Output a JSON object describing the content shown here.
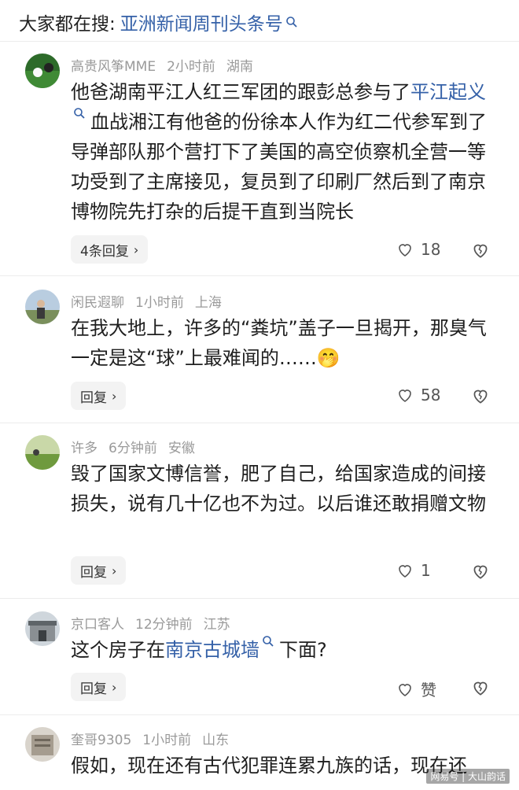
{
  "search": {
    "prefix": "大家都在搜:",
    "query": "亚洲新闻周刊头条号"
  },
  "comments": [
    {
      "user": "高贵风筝MME",
      "time": "2小时前",
      "location": "湖南",
      "text_before": "他爸湖南平江人红三军团的跟彭总参与了",
      "link": "平江起义",
      "text_after": "血战湘江有他爸的份徐本人作为红二代参军到了导弹部队那个营打下了美国的高空侦察机全营一等功受到了主席接见，复员到了印刷厂然后到了南京博物院先打杂的后提干直到当院长",
      "reply_label": "4条回复",
      "likes": "18"
    },
    {
      "user": "闲民遐聊",
      "time": "1小时前",
      "location": "上海",
      "text_before": "在我大地上，许多的“粪坑”盖子一旦揭开，那臭气一定是这“球”上最难闻的……",
      "emoji": "🤭",
      "reply_label": "回复",
      "likes": "58"
    },
    {
      "user": "许多",
      "time": "6分钟前",
      "location": "安徽",
      "text_before": "毁了国家文博信誉，肥了自己，给国家造成的间接损失，说有几十亿也不为过。以后谁还敢捐赠文物",
      "reply_label": "回复",
      "likes": "1"
    },
    {
      "user": "京口客人",
      "time": "12分钟前",
      "location": "江苏",
      "text_before": "这个房子在",
      "link": "南京古城墙",
      "text_after": "下面?",
      "reply_label": "回复",
      "likes": "赞"
    },
    {
      "user": "奎哥9305",
      "time": "1小时前",
      "location": "山东",
      "text_before": "假如，现在还有古代犯罪连累九族的话，现在还"
    }
  ],
  "watermark": "网易号 | 大山韵话",
  "colors": {
    "link": "#3561a8",
    "meta": "#9a9a9a"
  }
}
